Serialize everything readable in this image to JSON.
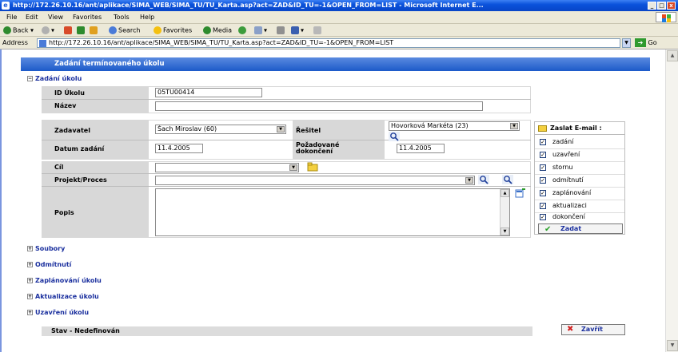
{
  "window": {
    "title": "http://172.26.10.16/ant/aplikace/SIMA_WEB/SIMA_TU/TU_Karta.asp?act=ZAD&ID_TU=-1&OPEN_FROM=LIST - Microsoft Internet E..."
  },
  "menu": {
    "items": [
      "File",
      "Edit",
      "View",
      "Favorites",
      "Tools",
      "Help"
    ]
  },
  "toolbar": {
    "back": "Back",
    "search": "Search",
    "favorites": "Favorites",
    "media": "Media"
  },
  "address": {
    "label": "Address",
    "url": "http://172.26.10.16/ant/aplikace/SIMA_WEB/SIMA_TU/TU_Karta.asp?act=ZAD&ID_TU=-1&OPEN_FROM=LIST",
    "go": "Go"
  },
  "form": {
    "header": "Zadání termínovaného úkolu",
    "section_main": "Zadání úkolu",
    "id_label": "ID Úkolu",
    "id_value": "05TU00414",
    "name_label": "Název",
    "name_value": "",
    "zadavatel_label": "Zadavatel",
    "zadavatel_value": "Šach Miroslav (60)",
    "resitel_label": "Řešitel",
    "resitel_value": "Hovorková Markéta (23)",
    "datum_label": "Datum zadání",
    "datum_value": "11.4.2005",
    "pozadovane_label_1": "Požadované",
    "pozadovane_label_2": "dokončení",
    "pozadovane_value": "11.4.2005",
    "cil_label": "Cíl",
    "cil_value": "",
    "projekt_label": "Projekt/Proces",
    "projekt_value": "",
    "popis_label": "Popis",
    "popis_value": ""
  },
  "email": {
    "title": "Zaslat E-mail :",
    "options": [
      {
        "label": "zadání",
        "checked": true
      },
      {
        "label": "uzavření",
        "checked": true
      },
      {
        "label": "stornu",
        "checked": true
      },
      {
        "label": "odmítnutí",
        "checked": true
      },
      {
        "label": "zaplánování",
        "checked": true
      },
      {
        "label": "aktualizaci",
        "checked": true
      },
      {
        "label": "dokončení",
        "checked": true
      }
    ],
    "submit": "Zadat"
  },
  "sections": [
    "Soubory",
    "Odmítnutí",
    "Zaplánování úkolu",
    "Aktualizace úkolu",
    "Uzavření úkolu"
  ],
  "status": {
    "text": "Stav  -  Nedefinován"
  },
  "close_button": "Zavřít",
  "colors": {
    "header_blue": "#1c5ac9",
    "section_link": "#1a2f9e",
    "grid_gray": "#d8d8d8"
  }
}
